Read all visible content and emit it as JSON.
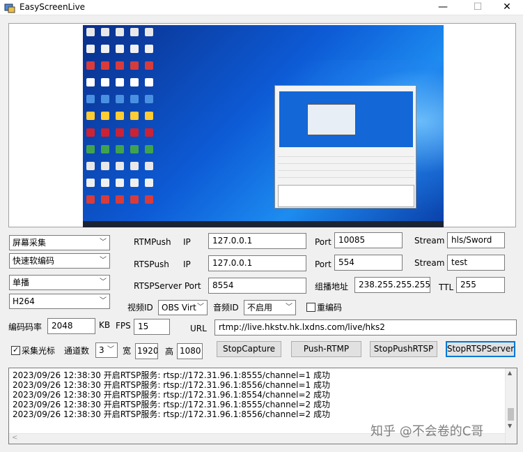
{
  "window": {
    "title": "EasyScreenLive",
    "minimize": "—",
    "maximize": "☐",
    "close": "✕"
  },
  "left_controls": {
    "capture_mode": "屏幕采集",
    "encoder": "快速软编码",
    "cast_mode": "单播",
    "codec": "H264"
  },
  "rtmp": {
    "label": "RTMPush",
    "ip_label": "IP",
    "ip": "127.0.0.1",
    "port_label": "Port",
    "port": "10085",
    "stream_label": "Stream",
    "stream": "hls/Sword"
  },
  "rtsp": {
    "label": "RTSPush",
    "ip_label": "IP",
    "ip": "127.0.0.1",
    "port_label": "Port",
    "port": "554",
    "stream_label": "Stream",
    "stream": "test"
  },
  "rtsp_server": {
    "label": "RTSPServer Port",
    "port": "8554",
    "multicast_label": "组播地址",
    "multicast": "238.255.255.255",
    "ttl_label": "TTL",
    "ttl": "255"
  },
  "video_id": {
    "label": "视频ID",
    "value": "OBS Virt"
  },
  "audio_id": {
    "label": "音频ID",
    "value": "不启用"
  },
  "reencode": {
    "label": "重编码",
    "checked": false
  },
  "bitrate": {
    "label": "编码码率",
    "value": "2048",
    "unit": "KB"
  },
  "fps": {
    "label": "FPS",
    "value": "15"
  },
  "url": {
    "label": "URL",
    "value": "rtmp://live.hkstv.hk.lxdns.com/live/hks2"
  },
  "cursor": {
    "label": "采集光标",
    "checked": true
  },
  "channels": {
    "label": "通道数",
    "value": "3"
  },
  "width": {
    "label": "宽",
    "value": "1920"
  },
  "height": {
    "label": "高",
    "value": "1080"
  },
  "buttons": {
    "stop_capture": "StopCapture",
    "push_rtmp": "Push-RTMP",
    "stop_push_rtsp": "StopPushRTSP",
    "stop_rtsp_server": "StopRTSPServer"
  },
  "log": [
    "2023/09/26 12:38:30   开启RTSP服务: rtsp://172.31.96.1:8555/channel=1 成功",
    "2023/09/26 12:38:30   开启RTSP服务: rtsp://172.31.96.1:8556/channel=1 成功",
    "2023/09/26 12:38:30   开启RTSP服务: rtsp://172.31.96.1:8554/channel=2 成功",
    "2023/09/26 12:38:30   开启RTSP服务: rtsp://172.31.96.1:8555/channel=2 成功",
    "2023/09/26 12:38:30   开启RTSP服务: rtsp://172.31.96.1:8556/channel=2 成功"
  ],
  "watermark": "知乎 @不会卷的C哥",
  "colors": {
    "desktop": "#0d5bd6",
    "accent": "#0078d7"
  }
}
